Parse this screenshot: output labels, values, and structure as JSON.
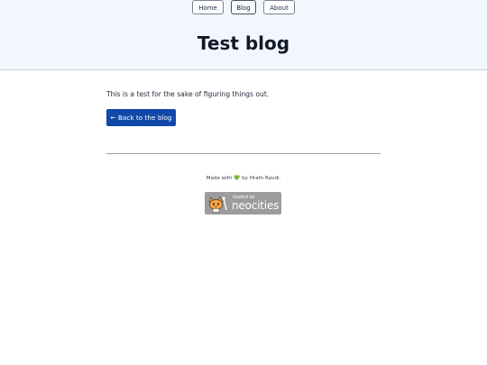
{
  "nav": {
    "items": [
      {
        "label": "Home"
      },
      {
        "label": "Blog"
      },
      {
        "label": "About"
      }
    ]
  },
  "header": {
    "title": "Test blog"
  },
  "post": {
    "body": "This is a test for the sake of figuring things out.",
    "back_label": "← Back to the blog"
  },
  "footer": {
    "made_with": "Made with",
    "heart": "💚",
    "by_text": "by Hrafn Ravdi.",
    "badge_small": "hosted by",
    "badge_big": "neocities"
  },
  "colors": {
    "header_bg": "#f2f6fd",
    "button_primary": "#1149a8",
    "badge_bg": "#9c9c9c"
  }
}
